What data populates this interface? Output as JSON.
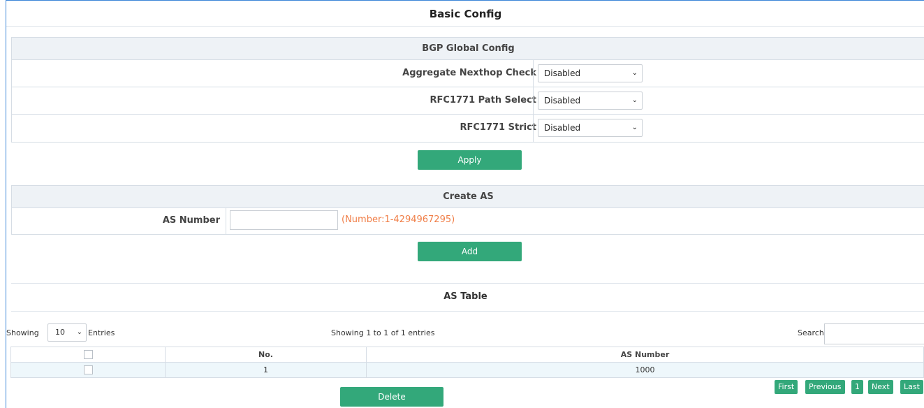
{
  "page": {
    "title": "Basic Config"
  },
  "bgp_global": {
    "header": "BGP Global Config",
    "rows": [
      {
        "label": "Aggregate Nexthop Check",
        "value": "Disabled"
      },
      {
        "label": "RFC1771 Path Select",
        "value": "Disabled"
      },
      {
        "label": "RFC1771 Strict",
        "value": "Disabled"
      }
    ],
    "apply_label": "Apply"
  },
  "create_as": {
    "header": "Create AS",
    "field_label": "AS Number",
    "input_value": "",
    "hint": "(Number:1-4294967295)",
    "add_label": "Add"
  },
  "as_table": {
    "header": "AS Table",
    "showing_label": "Showing",
    "page_size": "10",
    "entries_label": "Entries",
    "info": "Showing 1 to 1 of 1 entries",
    "search_label": "Search",
    "search_value": "",
    "columns": [
      "No.",
      "AS Number"
    ],
    "rows": [
      {
        "no": "1",
        "as_number": "1000"
      }
    ],
    "delete_label": "Delete",
    "pagination": {
      "first": "First",
      "previous": "Previous",
      "current": "1",
      "next": "Next",
      "last": "Last"
    }
  }
}
